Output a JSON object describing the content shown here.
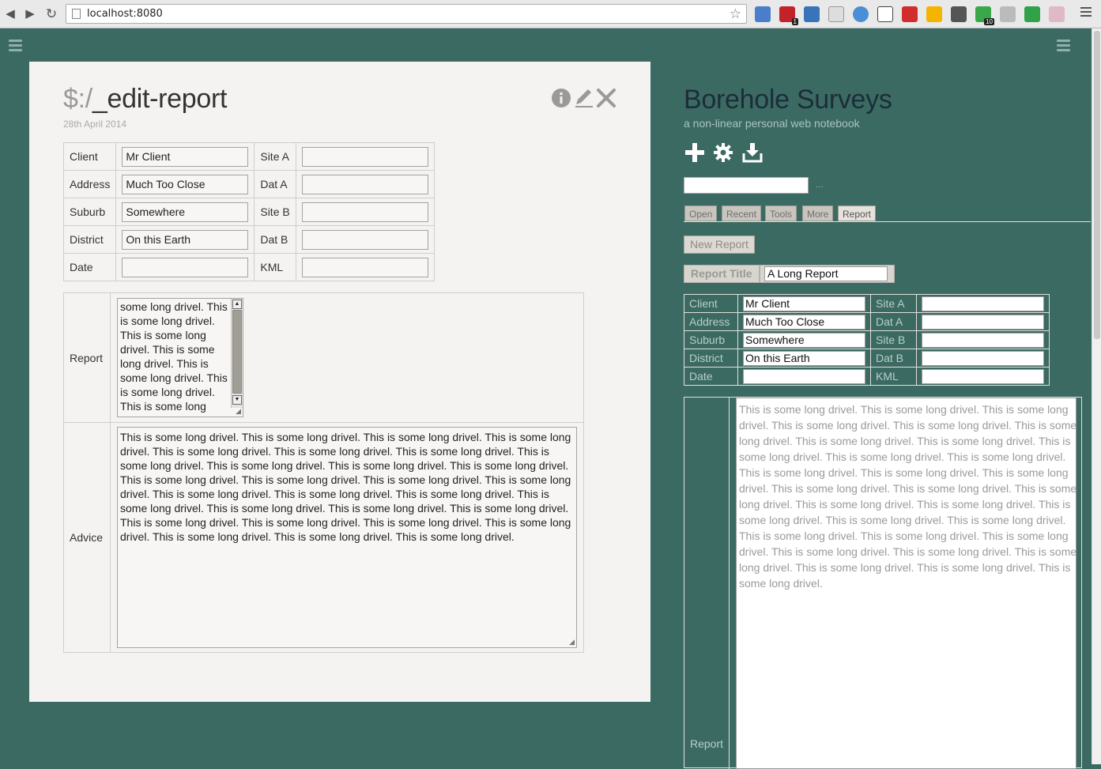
{
  "browser": {
    "url": "localhost:8080",
    "extension_badges": [
      "1",
      "10"
    ]
  },
  "tiddler": {
    "title_prefix": "$:/",
    "title_rest": "_edit-report",
    "date": "28th April 2014",
    "fields": {
      "client_label": "Client",
      "client_value": "Mr Client",
      "address_label": "Address",
      "address_value": "Much Too Close",
      "suburb_label": "Suburb",
      "suburb_value": "Somewhere",
      "district_label": "District",
      "district_value": "On this Earth",
      "date_label": "Date",
      "date_value": "",
      "site_a_label": "Site A",
      "site_a_value": "",
      "dat_a_label": "Dat A",
      "dat_a_value": "",
      "site_b_label": "Site B",
      "site_b_value": "",
      "dat_b_label": "Dat B",
      "dat_b_value": "",
      "kml_label": "KML",
      "kml_value": ""
    },
    "report_label": "Report",
    "report_text": "some long drivel. This is some long drivel. This is some long drivel. This is some long drivel. This is some long drivel. This is some long drivel. This is some long drivel.",
    "advice_label": "Advice",
    "advice_text": "This is some long drivel. This is some long drivel. This is some long drivel. This is some long drivel. This is some long drivel. This is some long drivel. This is some long drivel. This is some long drivel. This is some long drivel. This is some long drivel. This is some long drivel. This is some long drivel. This is some long drivel. This is some long drivel. This is some long drivel. This is some long drivel. This is some long drivel. This is some long drivel. This is some long drivel. This is some long drivel. This is some long drivel. This is some long drivel. This is some long drivel. This is some long drivel. This is some long drivel. This is some long drivel. This is some long drivel. This is some long drivel. This is some long drivel."
  },
  "sidebar": {
    "site_title": "Borehole Surveys",
    "site_subtitle": "a non-linear personal web notebook",
    "search_value": "",
    "search_more": "...",
    "tabs": [
      "Open",
      "Recent",
      "Tools",
      "More",
      "Report"
    ],
    "active_tab": "Report",
    "new_report_label": "New Report",
    "report_title_label": "Report Title",
    "report_title_value": "A Long Report",
    "fields": {
      "client_label": "Client",
      "client_value": "Mr Client",
      "address_label": "Address",
      "address_value": "Much Too Close",
      "suburb_label": "Suburb",
      "suburb_value": "Somewhere",
      "district_label": "District",
      "district_value": "On this Earth",
      "date_label": "Date",
      "date_value": "",
      "site_a_label": "Site A",
      "site_a_value": "",
      "dat_a_label": "Dat A",
      "dat_a_value": "",
      "site_b_label": "Site B",
      "site_b_value": "",
      "dat_b_label": "Dat B",
      "dat_b_value": "",
      "kml_label": "KML",
      "kml_value": ""
    },
    "report_label": "Report",
    "report_text": "This is some long drivel. This is some long drivel. This is some long drivel. This is some long drivel. This is some long drivel. This is some long drivel. This is some long drivel. This is some long drivel. This is some long drivel. This is some long drivel. This is some long drivel. This is some long drivel. This is some long drivel. This is some long drivel. This is some long drivel. This is some long drivel. This is some long drivel. This is some long drivel. This is some long drivel. This is some long drivel. This is some long drivel. This is some long drivel. This is some long drivel. This is some long drivel. This is some long drivel. This is some long drivel. This is some long drivel. This is some long drivel. This is some long drivel. This is some long drivel. This is some long drivel."
  },
  "colors": {
    "page_background": "#3b6a62",
    "tiddler_background": "#f4f3f1",
    "site_title": "#1c2d3a"
  },
  "icons": {
    "tiddler_controls": [
      "info-icon",
      "edit-icon",
      "close-icon"
    ],
    "sidebar_buttons": [
      "new-tiddler-icon",
      "control-panel-icon",
      "save-icon"
    ]
  }
}
